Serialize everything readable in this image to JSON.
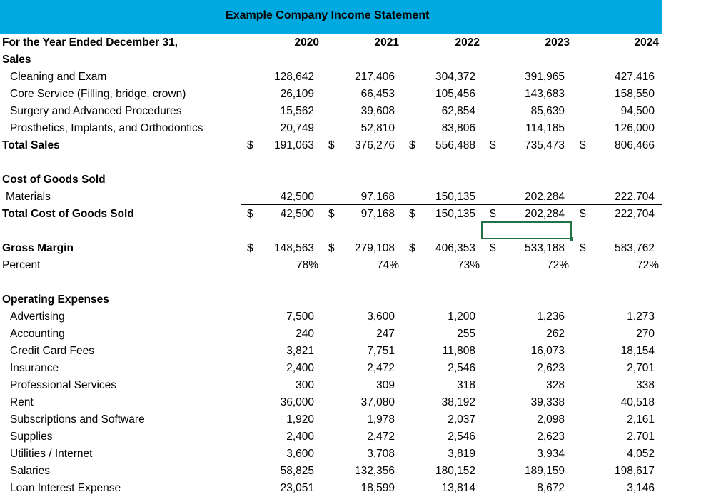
{
  "title": "Example Company Income Statement",
  "header": {
    "label": "For the Year Ended December 31,",
    "years": [
      "2020",
      "2021",
      "2022",
      "2023",
      "2024"
    ]
  },
  "sales": {
    "heading": "Sales",
    "items": [
      {
        "label": "Cleaning and Exam",
        "values": [
          "128,642",
          "217,406",
          "304,372",
          "391,965",
          "427,416"
        ]
      },
      {
        "label": "Core Service (Filling, bridge, crown)",
        "values": [
          "26,109",
          "66,453",
          "105,456",
          "143,683",
          "158,550"
        ]
      },
      {
        "label": "Surgery and Advanced Procedures",
        "values": [
          "15,562",
          "39,608",
          "62,854",
          "85,639",
          "94,500"
        ]
      },
      {
        "label": "Prosthetics, Implants, and Orthodontics",
        "values": [
          "20,749",
          "52,810",
          "83,806",
          "114,185",
          "126,000"
        ]
      }
    ],
    "total": {
      "label": "Total Sales",
      "values": [
        "191,063",
        "376,276",
        "556,488",
        "735,473",
        "806,466"
      ]
    }
  },
  "cogs": {
    "heading": "Cost of Goods Sold",
    "items": [
      {
        "label": "Materials",
        "values": [
          "42,500",
          "97,168",
          "150,135",
          "202,284",
          "222,704"
        ]
      }
    ],
    "total": {
      "label": "Total Cost of Goods Sold",
      "values": [
        "42,500",
        "97,168",
        "150,135",
        "202,284",
        "222,704"
      ]
    }
  },
  "gross": {
    "label": "Gross Margin",
    "values": [
      "148,563",
      "279,108",
      "406,353",
      "533,188",
      "583,762"
    ],
    "pct_label": "Percent",
    "pct": [
      "78%",
      "74%",
      "73%",
      "72%",
      "72%"
    ]
  },
  "opex": {
    "heading": "Operating Expenses",
    "items": [
      {
        "label": "Advertising",
        "values": [
          "7,500",
          "3,600",
          "1,200",
          "1,236",
          "1,273"
        ]
      },
      {
        "label": "Accounting",
        "values": [
          "240",
          "247",
          "255",
          "262",
          "270"
        ]
      },
      {
        "label": "Credit Card Fees",
        "values": [
          "3,821",
          "7,751",
          "11,808",
          "16,073",
          "18,154"
        ]
      },
      {
        "label": "Insurance",
        "values": [
          "2,400",
          "2,472",
          "2,546",
          "2,623",
          "2,701"
        ]
      },
      {
        "label": "Professional Services",
        "values": [
          "300",
          "309",
          "318",
          "328",
          "338"
        ]
      },
      {
        "label": "Rent",
        "values": [
          "36,000",
          "37,080",
          "38,192",
          "39,338",
          "40,518"
        ]
      },
      {
        "label": "Subscriptions and Software",
        "values": [
          "1,920",
          "1,978",
          "2,037",
          "2,098",
          "2,161"
        ]
      },
      {
        "label": "Supplies",
        "values": [
          "2,400",
          "2,472",
          "2,546",
          "2,623",
          "2,701"
        ]
      },
      {
        "label": "Utilities / Internet",
        "values": [
          "3,600",
          "3,708",
          "3,819",
          "3,934",
          "4,052"
        ]
      },
      {
        "label": "Salaries",
        "values": [
          "58,825",
          "132,356",
          "180,152",
          "189,159",
          "198,617"
        ]
      },
      {
        "label": "Loan Interest Expense",
        "values": [
          "23,051",
          "18,599",
          "13,814",
          "8,672",
          "3,146"
        ]
      }
    ]
  },
  "currency_symbol": "$",
  "colors": {
    "title_band": "#00a9e0",
    "selection": "#217346"
  }
}
